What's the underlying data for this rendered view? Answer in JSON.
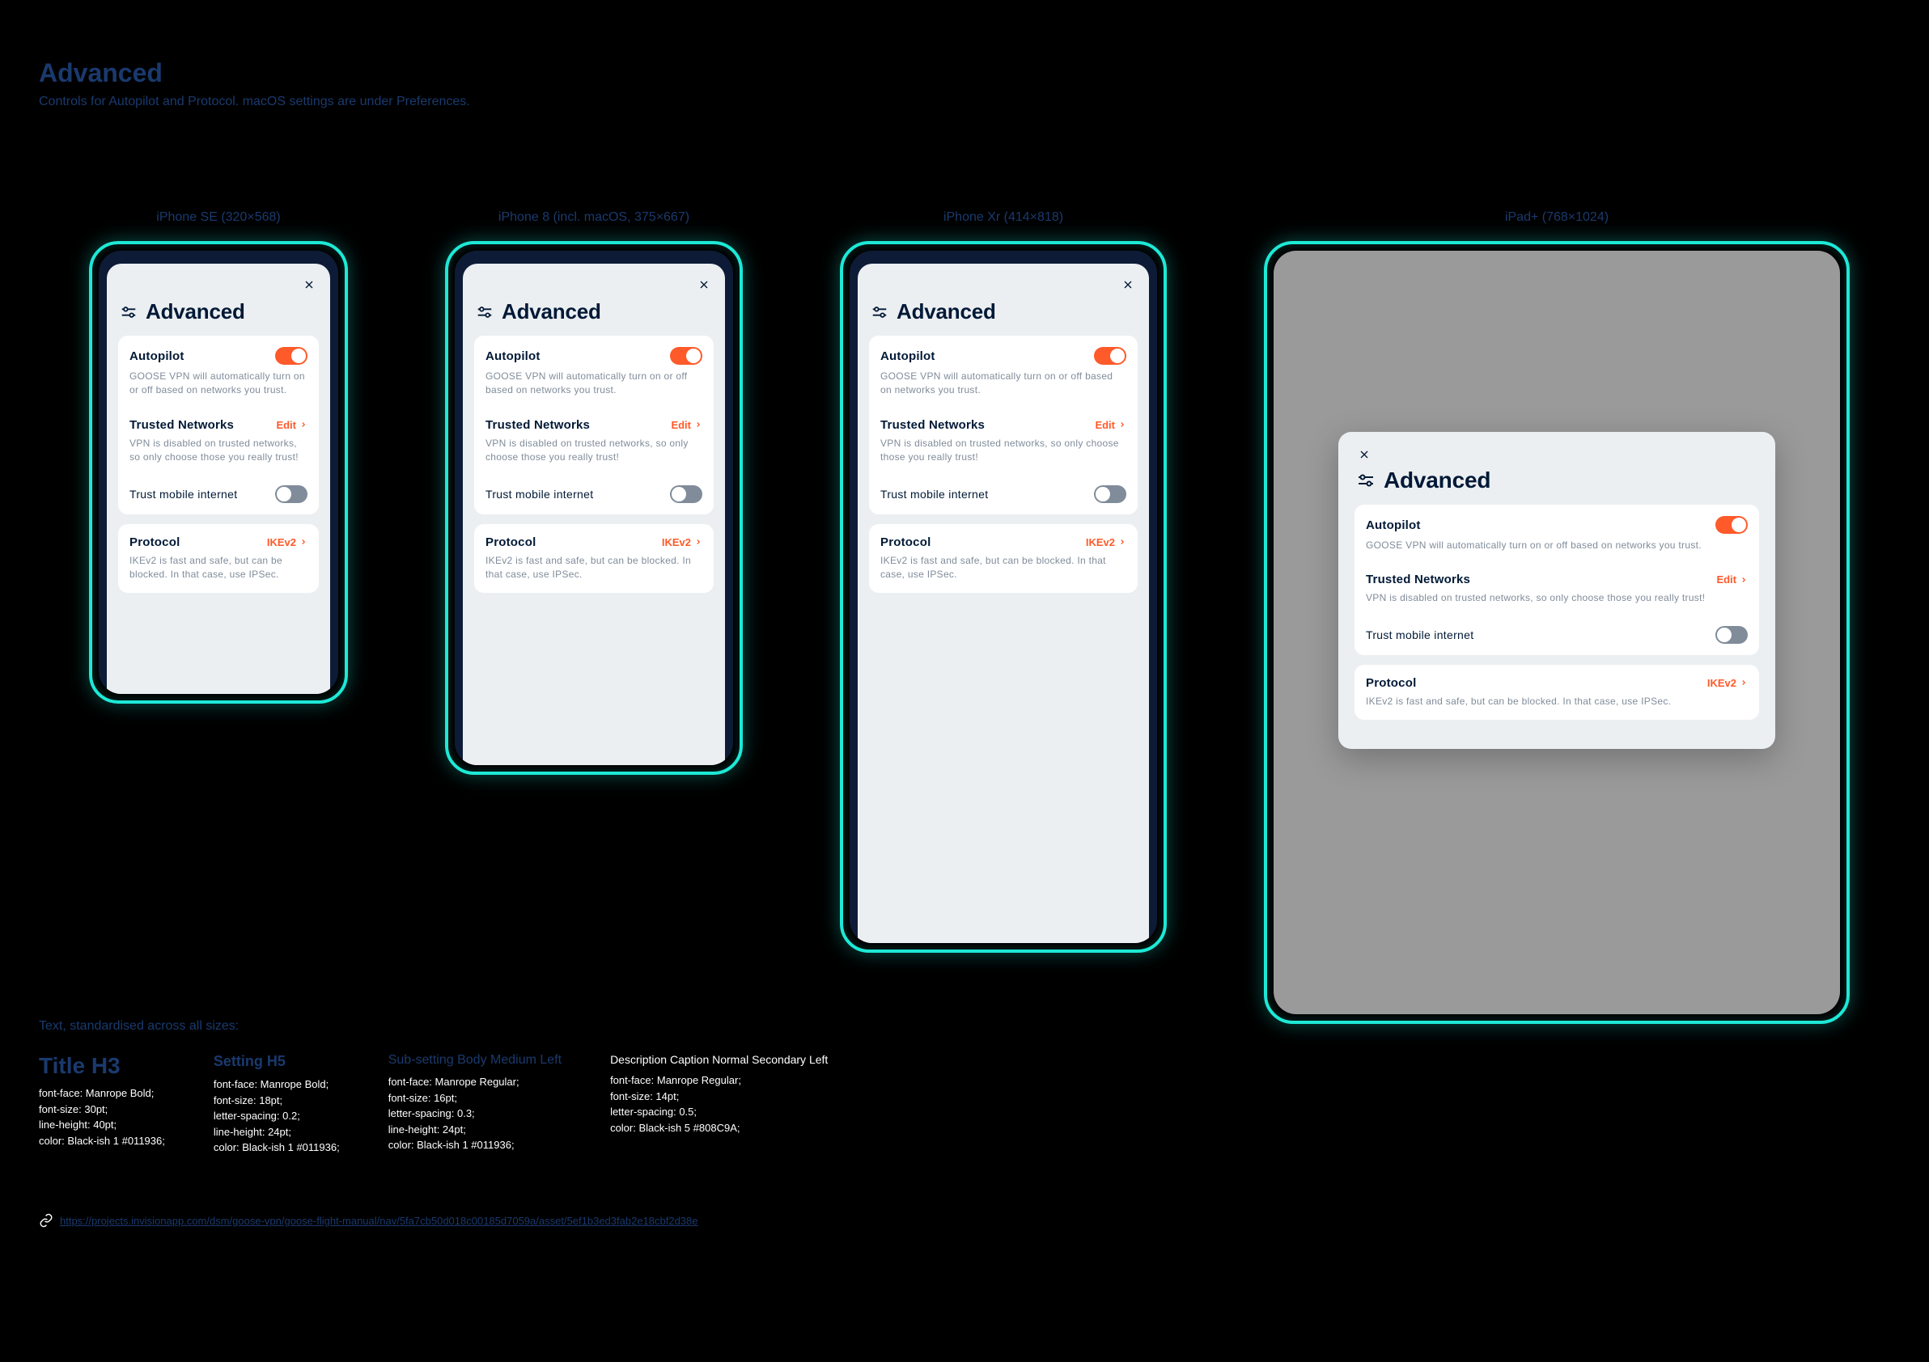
{
  "page": {
    "title": "Advanced",
    "subtitle": "Controls for Autopilot and Protocol. macOS settings are under Preferences."
  },
  "devices": {
    "se": "iPhone SE (320×568)",
    "eight": "iPhone 8 (incl. macOS, 375×667)",
    "xr": "iPhone Xr (414×818)",
    "ipad": "iPad+ (768×1024)"
  },
  "panel": {
    "title": "Advanced",
    "autopilot": {
      "title": "Autopilot",
      "desc_small": "GOOSE VPN will automatically turn on or off based on networks you trust.",
      "desc_mid": "GOOSE VPN will automatically turn on or off based on networks you trust.",
      "desc_wide": "GOOSE VPN will automatically turn on or off based on networks you trust."
    },
    "trusted": {
      "title": "Trusted Networks",
      "edit": "Edit",
      "desc_small": "VPN is disabled on trusted networks, so only choose those you really trust!",
      "desc_mid": "VPN is disabled on trusted networks, so only choose those you really trust!",
      "desc_wide": "VPN is disabled on trusted networks, so only choose those you really trust!"
    },
    "trust_mobile": "Trust mobile internet",
    "protocol": {
      "title": "Protocol",
      "value": "IKEv2",
      "desc_small": "IKEv2 is fast and safe, but can be blocked. In that case, use IPSec.",
      "desc_mid": "IKEv2 is fast and safe, but can be blocked. In that case, use IPSec.",
      "desc_wide": "IKEv2 is fast and safe, but can be blocked. In that case, use IPSec."
    }
  },
  "typespec": {
    "heading": "Text, standardised across all sizes:",
    "cols": {
      "title": {
        "sample": "Title H3",
        "spec": "font-face: Manrope Bold;\nfont-size: 30pt;\nline-height: 40pt;\ncolor: Black-ish 1 #011936;"
      },
      "setting": {
        "sample": "Setting H5",
        "spec": "font-face: Manrope Bold;\nfont-size: 18pt;\nletter-spacing: 0.2;\nline-height: 24pt;\ncolor: Black-ish 1 #011936;"
      },
      "subsetting": {
        "sample": "Sub-setting Body Medium Left",
        "spec": "font-face: Manrope Regular;\nfont-size: 16pt;\nletter-spacing: 0.3;\nline-height: 24pt;\ncolor: Black-ish 1 #011936;"
      },
      "description": {
        "sample": "Description Caption Normal Secondary Left",
        "spec": "font-face: Manrope Regular;\nfont-size: 14pt;\nletter-spacing: 0.5;\ncolor: Black-ish 5 #808C9A;"
      }
    }
  },
  "link": "https://projects.invisionapp.com/dsm/goose-vpn/goose-flight-manual/nav/5fa7cb50d018c00185d7059a/asset/5ef1b3ed3fab2e18cbf2d38e"
}
